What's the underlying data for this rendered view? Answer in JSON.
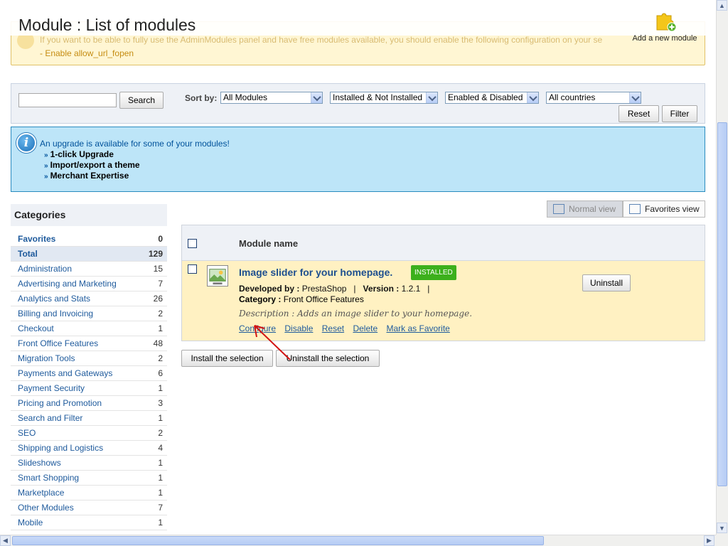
{
  "header": {
    "title": "Module : List of modules",
    "add_module_label": "Add a new module",
    "warning_text": "If you want to be able to fully use the AdminModules panel and have free modules available, you should enable the following configuration on your se",
    "warning_item": "- Enable allow_url_fopen"
  },
  "filter": {
    "search_value": "",
    "search_button": "Search",
    "sort_label": "Sort by:",
    "selects": [
      "All Modules",
      "Installed & Not Installed",
      "Enabled & Disabled",
      "All countries"
    ],
    "reset_button": "Reset",
    "filter_button": "Filter"
  },
  "upgrade": {
    "message": "An upgrade is available for some of your modules!",
    "links": [
      "1-click Upgrade",
      "Import/export a theme",
      "Merchant Expertise"
    ]
  },
  "categories": {
    "title": "Categories",
    "items": [
      {
        "name": "Favorites",
        "count": "0"
      },
      {
        "name": "Total",
        "count": "129"
      },
      {
        "name": "Administration",
        "count": "15"
      },
      {
        "name": "Advertising and Marketing",
        "count": "7"
      },
      {
        "name": "Analytics and Stats",
        "count": "26"
      },
      {
        "name": "Billing and Invoicing",
        "count": "2"
      },
      {
        "name": "Checkout",
        "count": "1"
      },
      {
        "name": "Front Office Features",
        "count": "48"
      },
      {
        "name": "Migration Tools",
        "count": "2"
      },
      {
        "name": "Payments and Gateways",
        "count": "6"
      },
      {
        "name": "Payment Security",
        "count": "1"
      },
      {
        "name": "Pricing and Promotion",
        "count": "3"
      },
      {
        "name": "Search and Filter",
        "count": "1"
      },
      {
        "name": "SEO",
        "count": "2"
      },
      {
        "name": "Shipping and Logistics",
        "count": "4"
      },
      {
        "name": "Slideshows",
        "count": "1"
      },
      {
        "name": "Smart Shopping",
        "count": "1"
      },
      {
        "name": "Marketplace",
        "count": "1"
      },
      {
        "name": "Other Modules",
        "count": "7"
      },
      {
        "name": "Mobile",
        "count": "1"
      }
    ]
  },
  "views": {
    "normal": "Normal view",
    "favorites": "Favorites view"
  },
  "table": {
    "column_title": "Module name",
    "module": {
      "name": "Image slider for your homepage.",
      "status_badge": "INSTALLED",
      "developed_by_label": "Developed by :",
      "developer": "PrestaShop",
      "version_label": "Version :",
      "version": "1.2.1",
      "category_label": "Category :",
      "category": "Front Office Features",
      "description_label": "Description :",
      "description": "Adds an image slider to your homepage.",
      "actions": [
        "Configure",
        "Disable",
        "Reset",
        "Delete",
        "Mark as Favorite"
      ],
      "uninstall_button": "Uninstall"
    },
    "install_selection": "Install the selection",
    "uninstall_selection": "Uninstall the selection"
  },
  "colors": {
    "accent": "#1e5a9c",
    "installed": "#3cb01c",
    "info_bg": "#bde5f8",
    "warning_bg": "#fff6d3"
  }
}
